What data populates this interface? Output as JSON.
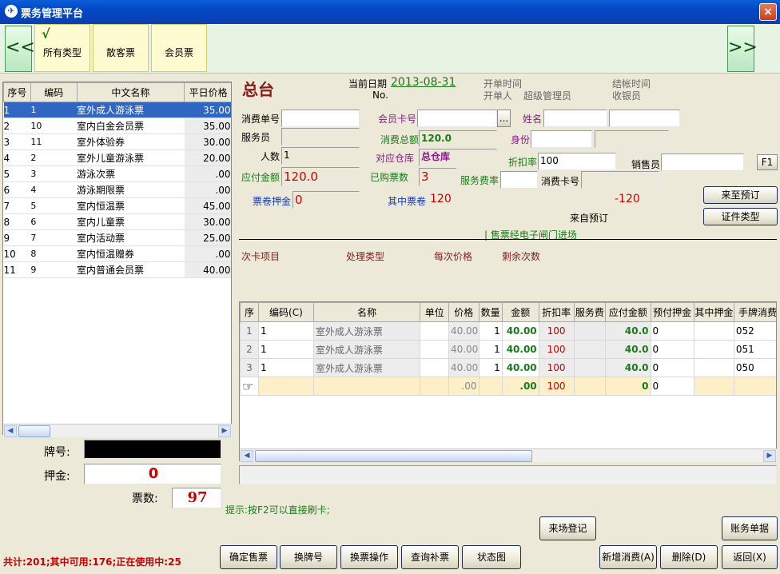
{
  "window": {
    "title": "票务管理平台",
    "close": "×"
  },
  "toolbar": {
    "prev": "<<",
    "next": ">>",
    "categories": [
      {
        "label": "所有类型",
        "checked": true,
        "check_mark": "√"
      },
      {
        "label": "散客票"
      },
      {
        "label": "会员票"
      }
    ]
  },
  "ticket_list": {
    "headers": [
      "序号",
      "编码",
      "中文名称",
      "平日价格"
    ],
    "rows": [
      {
        "seq": "1",
        "code": "1",
        "name": "室外成人游泳票",
        "price": "35.00",
        "selected": true
      },
      {
        "seq": "2",
        "code": "10",
        "name": "室内白金会员票",
        "price": "35.00"
      },
      {
        "seq": "3",
        "code": "11",
        "name": "室外体验券",
        "price": "30.00"
      },
      {
        "seq": "4",
        "code": "2",
        "name": "室外儿童游泳票",
        "price": "20.00"
      },
      {
        "seq": "5",
        "code": "3",
        "name": "游泳次票",
        "price": ".00"
      },
      {
        "seq": "6",
        "code": "4",
        "name": "游泳期限票",
        "price": ".00"
      },
      {
        "seq": "7",
        "code": "5",
        "name": "室内恒温票",
        "price": "45.00"
      },
      {
        "seq": "8",
        "code": "6",
        "name": "室内儿童票",
        "price": "30.00"
      },
      {
        "seq": "9",
        "code": "7",
        "name": "室内活动票",
        "price": "25.00"
      },
      {
        "seq": "10",
        "code": "8",
        "name": "室内恒温赠券",
        "price": ".00"
      },
      {
        "seq": "11",
        "code": "9",
        "name": "室内普通会员票",
        "price": "40.00"
      }
    ]
  },
  "left_bottom": {
    "plate_label": "牌号:",
    "plate_value": "",
    "deposit_label": "押金:",
    "deposit_value": "0",
    "ticket_count_label": "票数:",
    "ticket_count_value": "97",
    "summary": "共计:201;其中可用:176;正在使用中:25"
  },
  "header": {
    "title": "总台",
    "date_label": "当前日期",
    "date_value": "2013-08-31",
    "no_label": "No.",
    "open_time_label": "开单时间",
    "opener_label": "开单人",
    "opener_value": "超级管理员",
    "close_time_label": "结帐时间",
    "cashier_label": "收银员"
  },
  "form": {
    "order_no_label": "消费单号",
    "order_no_value": "",
    "waiter_label": "服务员",
    "waiter_value": "",
    "people_label": "人数",
    "people_value": "1",
    "payable_label": "应付金额",
    "payable_value": "120.0",
    "member_card_label": "会员卡号",
    "member_card_value": "",
    "ellipsis": "...",
    "name_label": "姓名",
    "name_value": "",
    "total_label": "消费总额",
    "total_value": "120.0",
    "identity_label": "身份",
    "warehouse_label": "对应仓库",
    "warehouse_value": "总仓库",
    "discount_label": "折扣率",
    "discount_value": "100",
    "seller_label": "销售员",
    "f1": "F1",
    "bought_label": "已购票数",
    "bought_value": "3",
    "service_rate_label": "服务费率",
    "service_rate_value": "",
    "consume_card_label": "消费卡号",
    "consume_card_value": "",
    "voucher_deposit_label": "票卷押金",
    "voucher_deposit_value": "0",
    "voucher_label": "其中票卷",
    "voucher_value": "120",
    "diff_value": "-120",
    "from_reservation": "来自预订",
    "gate_note": "| 售票经电子闸门进场"
  },
  "side_buttons": {
    "reserve": "来至预订",
    "id_type": "证件类型"
  },
  "card_section": {
    "headers": [
      "次卡项目",
      "处理类型",
      "每次价格",
      "剩余次数"
    ]
  },
  "detail_grid": {
    "headers": [
      "序",
      "编码(C)",
      "名称",
      "单位",
      "价格",
      "数量",
      "金额",
      "折扣率",
      "服务费",
      "应付金额",
      "预付押金",
      "其中押金",
      "手牌消费卡"
    ],
    "rows": [
      {
        "seq": "1",
        "code": "1",
        "name": "室外成人游泳票",
        "unit": "",
        "price": "40.00",
        "qty": "1",
        "amount": "40.00",
        "discount": "100",
        "service": "",
        "payable": "40.0",
        "prepay": "0",
        "deposit": "",
        "card": "052"
      },
      {
        "seq": "2",
        "code": "1",
        "name": "室外成人游泳票",
        "unit": "",
        "price": "40.00",
        "qty": "1",
        "amount": "40.00",
        "discount": "100",
        "service": "",
        "payable": "40.0",
        "prepay": "0",
        "deposit": "",
        "card": "051"
      },
      {
        "seq": "3",
        "code": "1",
        "name": "室外成人游泳票",
        "unit": "",
        "price": "40.00",
        "qty": "1",
        "amount": "40.00",
        "discount": "100",
        "service": "",
        "payable": "40.0",
        "prepay": "0",
        "deposit": "",
        "card": "050"
      }
    ],
    "new_row": {
      "price": ".00",
      "amount": ".00",
      "discount": "100",
      "payable": "0",
      "prepay": "0"
    }
  },
  "hint": "提示:按F2可以直接刷卡;",
  "buttons": {
    "arrival": "来场登记",
    "account_list": "账务单据",
    "confirm_sale": "确定售票",
    "change_plate": "换牌号",
    "change_ticket": "换票操作",
    "query_refill": "查询补票",
    "status_chart": "状态图",
    "new_consume": "新增消费(A)",
    "delete": "删除(D)",
    "back": "返回(X)"
  },
  "colors": {
    "title_bar": "#0a4fcb",
    "selection": "#3166c2",
    "accent_red": "#cc0000",
    "accent_green": "#1a7a1a"
  }
}
